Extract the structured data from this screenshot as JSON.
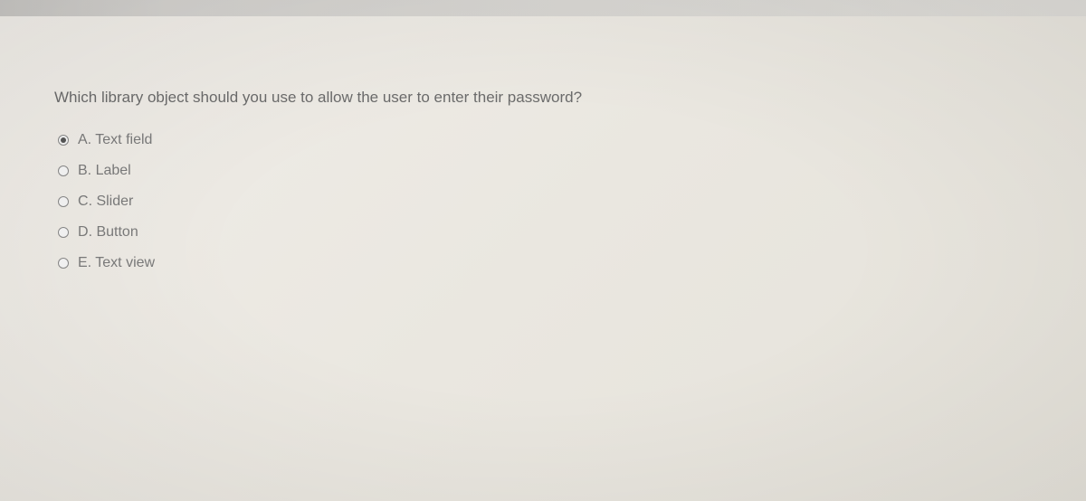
{
  "question": "Which library object should you use to allow the user to enter their password?",
  "options": [
    {
      "letter": "A",
      "text": "Text field",
      "selected": true
    },
    {
      "letter": "B",
      "text": "Label",
      "selected": false
    },
    {
      "letter": "C",
      "text": "Slider",
      "selected": false
    },
    {
      "letter": "D",
      "text": "Button",
      "selected": false
    },
    {
      "letter": "E",
      "text": "Text view",
      "selected": false
    }
  ]
}
